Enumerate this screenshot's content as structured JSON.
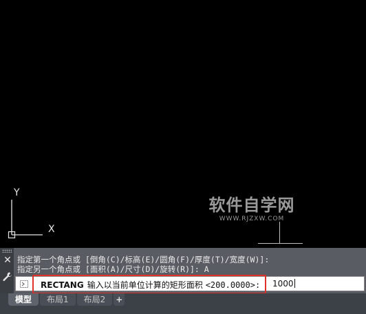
{
  "viewport": {
    "ucs_axis_x": "X",
    "ucs_axis_y": "Y"
  },
  "watermark": {
    "title": "软件自学网",
    "url": "WWW.RJZXW.COM"
  },
  "command_line": {
    "history": [
      "指定第一个角点或 [倒角(C)/标高(E)/圆角(F)/厚度(T)/宽度(W)]:",
      "指定另一个角点或 [面积(A)/尺寸(D)/旋转(R)]: A"
    ],
    "prompt_command": "RECTANG",
    "prompt_message": "输入以当前单位计算的矩形面积",
    "prompt_default": "<200.0000>:",
    "input_value": "1000"
  },
  "tabs": [
    "模型",
    "布局1",
    "布局2"
  ],
  "tab_add_label": "+",
  "icons": {
    "close": "close-icon",
    "settings": "wrench-icon",
    "prompt": "command-prompt-icon"
  },
  "colors": {
    "canvas_background": "#000000",
    "highlight_border": "#e0302a",
    "command_panel": "#595d63"
  }
}
